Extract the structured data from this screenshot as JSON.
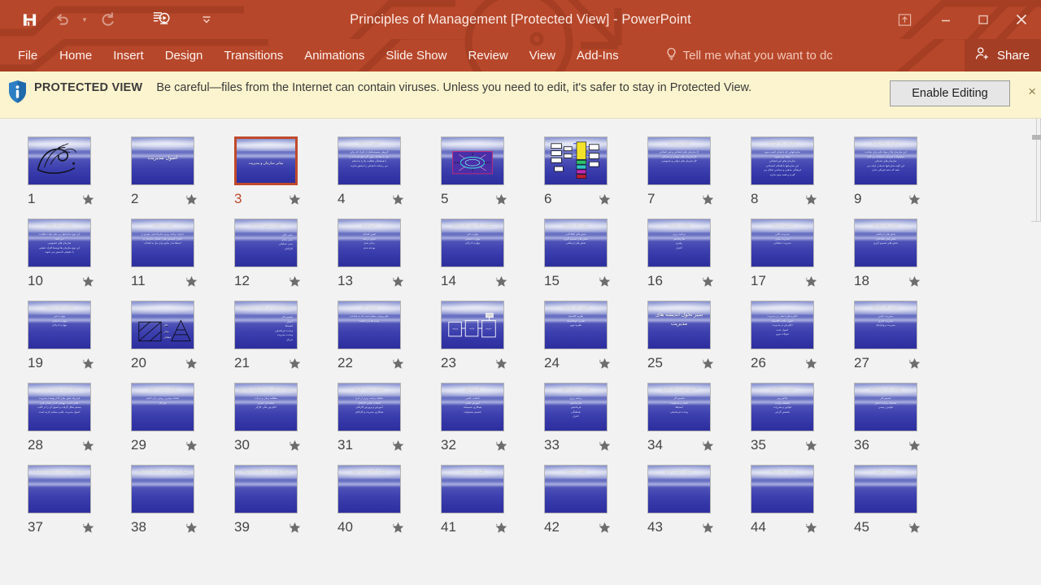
{
  "window": {
    "title": "Principles of Management [Protected View] - PowerPoint",
    "accent_color": "#b7472a",
    "quick_access": [
      {
        "name": "save-icon",
        "label": "Save",
        "state": "enabled"
      },
      {
        "name": "undo-icon",
        "label": "Undo",
        "state": "disabled"
      },
      {
        "name": "redo-icon",
        "label": "Repeat",
        "state": "disabled"
      },
      {
        "name": "start-slideshow-icon",
        "label": "Start From Beginning",
        "state": "enabled"
      }
    ],
    "customize_qat_label": "Customize Quick Access Toolbar",
    "controls": [
      {
        "name": "ribbon-display-options-icon",
        "label": "Ribbon Display Options"
      },
      {
        "name": "minimize-icon",
        "label": "Minimize"
      },
      {
        "name": "maximize-icon",
        "label": "Restore Down"
      },
      {
        "name": "close-icon",
        "label": "Close"
      }
    ]
  },
  "ribbon": {
    "tabs": [
      {
        "label": "File"
      },
      {
        "label": "Home"
      },
      {
        "label": "Insert"
      },
      {
        "label": "Design"
      },
      {
        "label": "Transitions"
      },
      {
        "label": "Animations"
      },
      {
        "label": "Slide Show"
      },
      {
        "label": "Review"
      },
      {
        "label": "View"
      },
      {
        "label": "Add-Ins"
      }
    ],
    "tell_me": "Tell me what you want to dc",
    "tell_me_icon": "lightbulb-icon",
    "share_label": "Share",
    "share_icon": "person-add-icon"
  },
  "protected_view": {
    "icon": "shield-info-icon",
    "label": "PROTECTED VIEW",
    "message": "Be careful—files from the Internet can contain viruses. Unless you need to edit, it's safer to stay in Protected View.",
    "enable_button": "Enable Editing",
    "close_label": "×",
    "background_color": "#fcf4ce"
  },
  "slide_sorter": {
    "selected_slide": 3,
    "star_icon": "star-icon",
    "slides": [
      {
        "n": 1,
        "kind": "image",
        "title": "",
        "lines": []
      },
      {
        "n": 2,
        "kind": "title",
        "title": "اصول مدیریت",
        "lines": []
      },
      {
        "n": 3,
        "kind": "title-mid",
        "title": "مبانی سازمان و مدیریت",
        "lines": []
      },
      {
        "n": 4,
        "kind": "text",
        "title": "تعریف سازمان",
        "lines": [
          "گروهی سیستماتیک از افراد که برای",
          "نیل به اهداف معین گرد هم آمده اند و",
          "با هماهنگی فعالیت ها را به انجام",
          "می رسانند تا هدفی را محقق سازند"
        ]
      },
      {
        "n": 5,
        "kind": "diagram-oval",
        "title": "",
        "lines": []
      },
      {
        "n": 6,
        "kind": "diagram-chart",
        "title": "",
        "lines": []
      },
      {
        "n": 7,
        "kind": "text",
        "title": "انواع سازمان ها",
        "lines": [
          "۱) سازمان های انتفاعی و غیر انتفاعی",
          "۲) سازمان های تولیدی و خدماتی",
          "۳) سازمان های دولتی و خصوصی"
        ]
      },
      {
        "n": 8,
        "kind": "text",
        "title": "سازمان های انتفاعی",
        "lines": [
          "سازمانهایی که با هدف کسب سود",
          "ایجاد می شوند",
          "سازمان های غیر انتفاعی",
          "این سازمانها با اهداف اجتماعی",
          "فرهنگی مذهبی و سیاسی شکل می",
          "گیرند و قصد سود ندارند"
        ]
      },
      {
        "n": 9,
        "kind": "text",
        "title": "سازمان های تولیدی",
        "lines": [
          "این سازمان ها از مواد خام برای ساخت",
          "محصولات فیزیکی استفاده می کنند",
          "سازمان های خدماتی",
          "این گونه سازمانها خدماتی ارائه می",
          "دهند که جنبه فیزیکی ندارد"
        ]
      },
      {
        "n": 10,
        "kind": "text",
        "title": "سازمان های دولتی",
        "lines": [
          "این نوع سازمانها زیر نظر دولت فعالیت",
          "می کنند",
          "سازمان های خصوصی",
          "این نوع سازمان ها توسط افراد حقیقی",
          "یا حقوقی تاسیس می شوند"
        ]
      },
      {
        "n": 11,
        "kind": "text",
        "title": "تعریف مدیریت",
        "lines": [
          "فرایند برنامه ریزی سازماندهی رهبری و",
          "کنترل کوشش های اعضای سازمان و",
          "استفاده از منابع برای نیل به اهداف"
        ]
      },
      {
        "n": 12,
        "kind": "two-col",
        "title": "انواع سطوح سازمانی",
        "lines": [
          "مدیر عالی",
          "مدیر میانی",
          "مدیر عملیاتی",
          "کارکنان"
        ]
      },
      {
        "n": 13,
        "kind": "text",
        "title": "طرح ریزی",
        "lines": [
          "تعیین اهداف",
          "تدوین برنامه",
          "زمان بندی",
          "بودجه بندی"
        ]
      },
      {
        "n": 14,
        "kind": "text",
        "title": "مهارت های مورد نیاز مدیران",
        "lines": [
          "مهارت فنی",
          "مهارت انسانی",
          "مهارت ادراکی"
        ]
      },
      {
        "n": 15,
        "kind": "text",
        "title": "نقش های مدیریتی",
        "lines": [
          "نقش های اطلاعاتی",
          "نقش های تصمیم گیری",
          "نقش های ارتباطی"
        ]
      },
      {
        "n": 16,
        "kind": "text",
        "title": "وظایف مدیریت",
        "lines": [
          "برنامه ریزی",
          "سازماندهی",
          "رهبری",
          "کنترل"
        ]
      },
      {
        "n": 17,
        "kind": "text",
        "title": "سطوح مدیریت",
        "lines": [
          "مدیریت عالی",
          "مدیریت میانی",
          "مدیریت عملیاتی"
        ]
      },
      {
        "n": 18,
        "kind": "text",
        "title": "نقش های مدیران",
        "lines": [
          "نقش های ارتباطی",
          "نقش های اطلاعاتی",
          "نقش های تصمیم گیری"
        ]
      },
      {
        "n": 19,
        "kind": "text",
        "title": "مهارت های مدیریتی",
        "lines": [
          "مهارت فنی",
          "مهارت انسانی",
          "مهارت ادراکی"
        ]
      },
      {
        "n": 20,
        "kind": "diagram-geo",
        "title": "رابطه بین سطوح مدیریت و مهارت های مورد نیاز",
        "lines": []
      },
      {
        "n": 21,
        "kind": "two-col",
        "title": "اصول مدیریت در نظریه تصدی اداری",
        "lines": [
          "تقسیم کار",
          "اختیار",
          "انضباط",
          "وحدت فرماندهی",
          "وحدت مدیریت",
          "تمرکز"
        ]
      },
      {
        "n": 22,
        "kind": "text",
        "title": "تعریف علم",
        "lines": [
          "علم روشی منظم است که به شناخت",
          "پدیده ها می انجامد"
        ]
      },
      {
        "n": 23,
        "kind": "diagram-box",
        "title": "نمودار سیستمی",
        "lines": []
      },
      {
        "n": 24,
        "kind": "text",
        "title": "نظریه های مدیریت",
        "lines": [
          "نظریه کلاسیک",
          "نظریه نئوکلاسیک",
          "نظریه نوین"
        ]
      },
      {
        "n": 25,
        "kind": "title-big",
        "title": "سیر تحول اندیشه های مدیریت",
        "lines": []
      },
      {
        "n": 26,
        "kind": "text",
        "title": "",
        "lines": [
          "انگیزه های اصلی در مدیریت",
          "اصول مکتب کلاسیک",
          "انگیزش در مدیریت",
          "اصول جدید",
          "تحولات نوین"
        ]
      },
      {
        "n": 27,
        "kind": "text",
        "title": "نظریه های کلاسیک",
        "lines": [
          "مدیریت علمی",
          "مدیریت اداری",
          "مدیریت بروکراتیک"
        ]
      },
      {
        "n": 28,
        "kind": "text",
        "title": "هدف تئوری مدیریت علمی",
        "lines": [
          "فردریک تیلور بنیان گذار نهضت مدیریت",
          "علمی است. نهضتی که از ابتدای قرن",
          "بیستم شکل گرفت و اصول آن را در کتاب",
          "اصول مدیریت علمی منتشر کرده است"
        ]
      },
      {
        "n": 29,
        "kind": "text",
        "title": "شعار مدیریت علمی",
        "lines": [
          "انتخاب بهترین روش برای انجام",
          "هر کار"
        ]
      },
      {
        "n": 30,
        "kind": "text",
        "title": "شیوه های تیلور برای افزایش بهره وری نیروی انسانی",
        "lines": [
          "مطالعه زمان و حرکت",
          "استاندارد سازی",
          "انگیزش مالی کارگر"
        ]
      },
      {
        "n": 31,
        "kind": "text",
        "title": "اصول مدیریت علمی",
        "lines": [
          "تفکیک برنامه ریزی از اجرا",
          "انتخاب علمی کارکنان",
          "آموزش و پرورش کارکنان",
          "همکاری مدیریت و کارکنان"
        ]
      },
      {
        "n": 32,
        "kind": "text",
        "title": "اصول تیلور",
        "lines": [
          "انتخاب علمی",
          "آموزش علمی",
          "همکاری صمیمانه",
          "تقسیم مسئولیت"
        ]
      },
      {
        "n": 33,
        "kind": "text",
        "title": "مدیریت اداری فایول",
        "lines": [
          "برنامه ریزی",
          "سازماندهی",
          "فرماندهی",
          "هماهنگی",
          "کنترل"
        ]
      },
      {
        "n": 34,
        "kind": "text",
        "title": "اصول چهارده گانه فایول",
        "lines": [
          "تقسیم کار",
          "اختیار و مسئولیت",
          "انضباط",
          "وحدت فرماندهی"
        ]
      },
      {
        "n": 35,
        "kind": "text",
        "title": "نظریه بروکراسی",
        "lines": [
          "ماکس وبر",
          "سلسله مراتب",
          "قوانین و مقررات",
          "تخصص گرایی"
        ]
      },
      {
        "n": 36,
        "kind": "text",
        "title": "ویژگی های بروکراسی",
        "lines": [
          "تقسیم کار",
          "سلسله مراتب اختیار",
          "قوانین رسمی"
        ]
      },
      {
        "n": 37,
        "kind": "text",
        "title": "بحث روابط انسانی و نظریه مناسبات",
        "lines": []
      },
      {
        "n": 38,
        "kind": "text",
        "title": "نظریه التون مایو و مطالعات هاثورن",
        "lines": []
      },
      {
        "n": 39,
        "kind": "text",
        "title": "چهار دوره اصلی مطالعات هاثورن",
        "lines": []
      },
      {
        "n": 40,
        "kind": "text",
        "title": "نظریه های مدیریت نوین",
        "lines": []
      },
      {
        "n": 41,
        "kind": "text",
        "title": "نظریه سیستم ها",
        "lines": []
      },
      {
        "n": 42,
        "kind": "text",
        "title": "نظریه اقتضایی",
        "lines": []
      },
      {
        "n": 43,
        "kind": "text",
        "title": "مدیریت کیفیت جامع",
        "lines": []
      },
      {
        "n": 44,
        "kind": "text",
        "title": "نظریه های رفتاری",
        "lines": []
      },
      {
        "n": 45,
        "kind": "text",
        "title": "مدیریت دانش",
        "lines": []
      }
    ]
  }
}
